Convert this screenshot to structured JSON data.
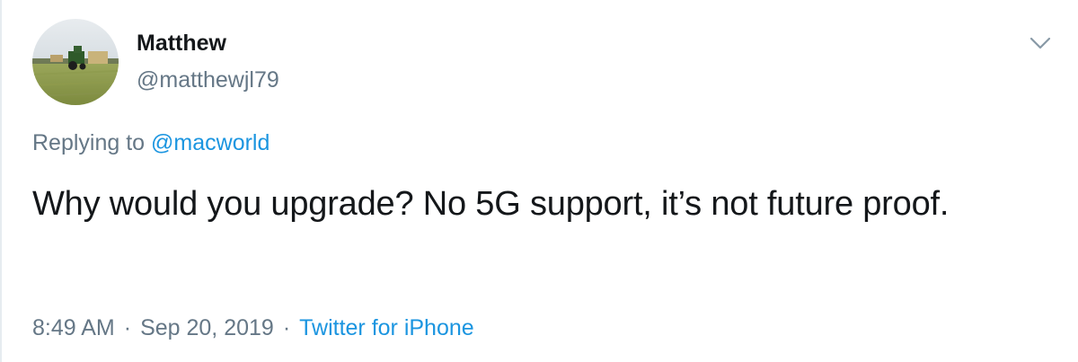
{
  "tweet": {
    "author": {
      "display_name": "Matthew",
      "handle": "@matthewjl79",
      "avatar_icon": "profile-photo-tractor-field"
    },
    "more_icon": "chevron-down-icon",
    "reply": {
      "prefix": "Replying to",
      "mention": "@macworld"
    },
    "text": "Why would you upgrade? No 5G support, it’s not future proof.",
    "meta": {
      "time": "8:49 AM",
      "separator": "·",
      "date": "Sep 20, 2019",
      "source": "Twitter for iPhone"
    },
    "colors": {
      "text": "#14171a",
      "secondary": "#657786",
      "link": "#1b95e0",
      "border": "#e6ecf0"
    }
  }
}
